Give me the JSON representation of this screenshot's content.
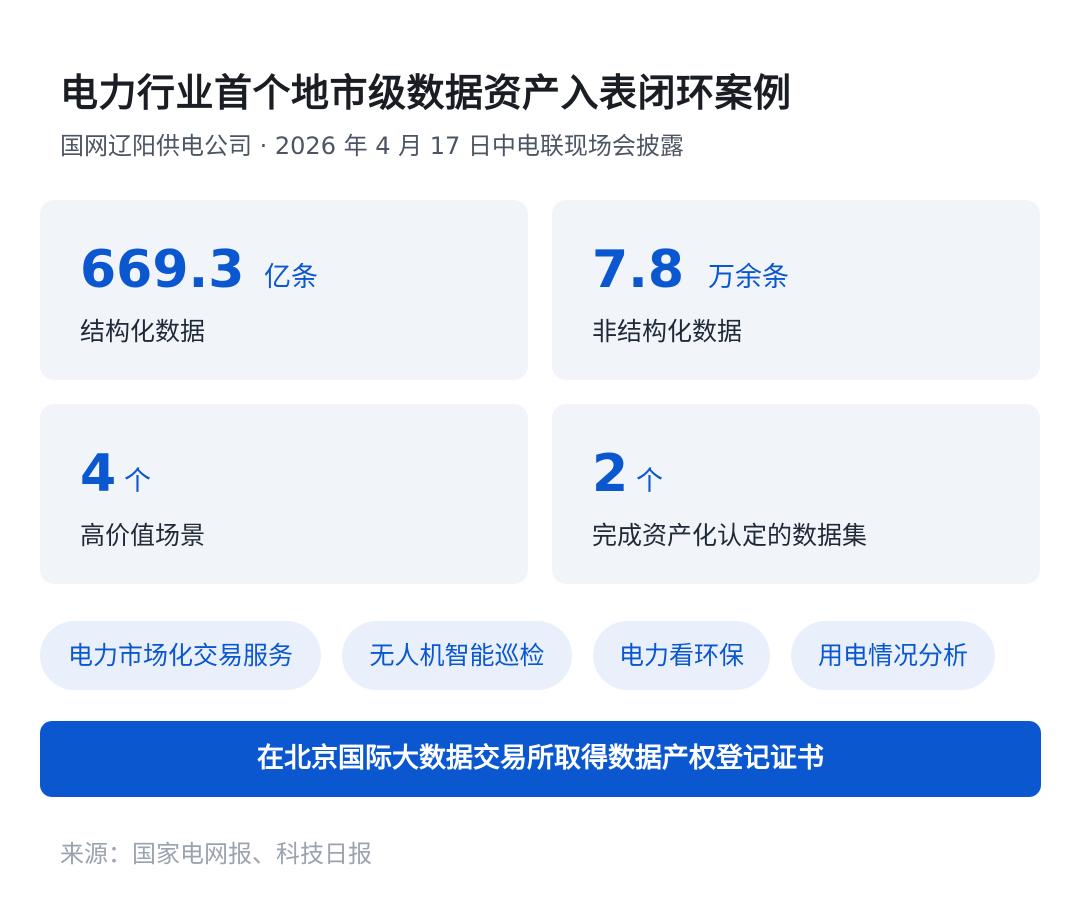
{
  "header": {
    "title": "电力行业首个地市级数据资产入表闭环案例",
    "subtitle": "国网辽阳供电公司 · 2026 年 4 月 17 日中电联现场会披露"
  },
  "stats": [
    {
      "value": "669.3",
      "unit": "亿条",
      "label": "结构化数据"
    },
    {
      "value": "7.8",
      "unit": "万余条",
      "label": "非结构化数据"
    },
    {
      "value": "4",
      "unit": "个",
      "label": "高价值场景"
    },
    {
      "value": "2",
      "unit": "个",
      "label": "完成资产化认定的数据集"
    }
  ],
  "tags": [
    "电力市场化交易服务",
    "无人机智能巡检",
    "电力看环保",
    "用电情况分析"
  ],
  "banner": {
    "text": "在北京国际大数据交易所取得数据产权登记证书"
  },
  "footer": {
    "source": "来源：国家电网报、科技日报"
  },
  "colors": {
    "accent": "#0b57d0",
    "card_bg": "#f1f4f9",
    "tag_bg": "#e9f0fb"
  }
}
